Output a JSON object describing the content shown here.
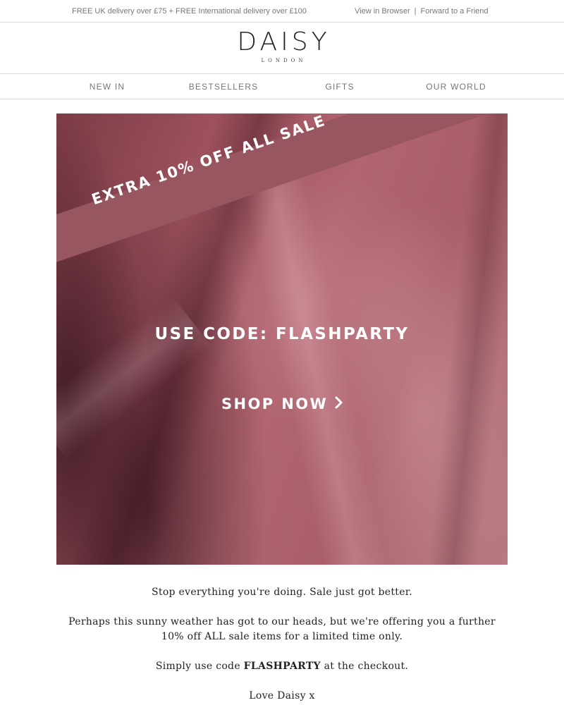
{
  "topbar": {
    "promo": "FREE UK delivery over £75 + FREE International delivery over £100",
    "view_in_browser": "View in Browser",
    "separator": "|",
    "forward": "Forward to a Friend"
  },
  "logo": {
    "wordmark": "DAISY",
    "subtitle": "LONDON"
  },
  "nav": {
    "items": [
      {
        "label": "NEW IN"
      },
      {
        "label": "BESTSELLERS"
      },
      {
        "label": "GIFTS"
      },
      {
        "label": "OUR WORLD"
      }
    ]
  },
  "hero": {
    "ribbon": "EXTRA 10% OFF ALL SALE",
    "code": "USE CODE: FLASHPARTY",
    "cta": "SHOP NOW",
    "cta_icon": "chevron-right-icon",
    "background_color": "#a0535f",
    "ribbon_color": "#985660"
  },
  "copy": {
    "line1": "Stop everything you're doing. Sale just got better.",
    "line2": "Perhaps this sunny weather has got to our heads, but we're offering you a further 10% off ALL sale items for a limited time only.",
    "line3_before": "Simply use code ",
    "line3_code": "FLASHPARTY",
    "line3_after": " at the checkout.",
    "signoff": "Love Daisy x"
  }
}
